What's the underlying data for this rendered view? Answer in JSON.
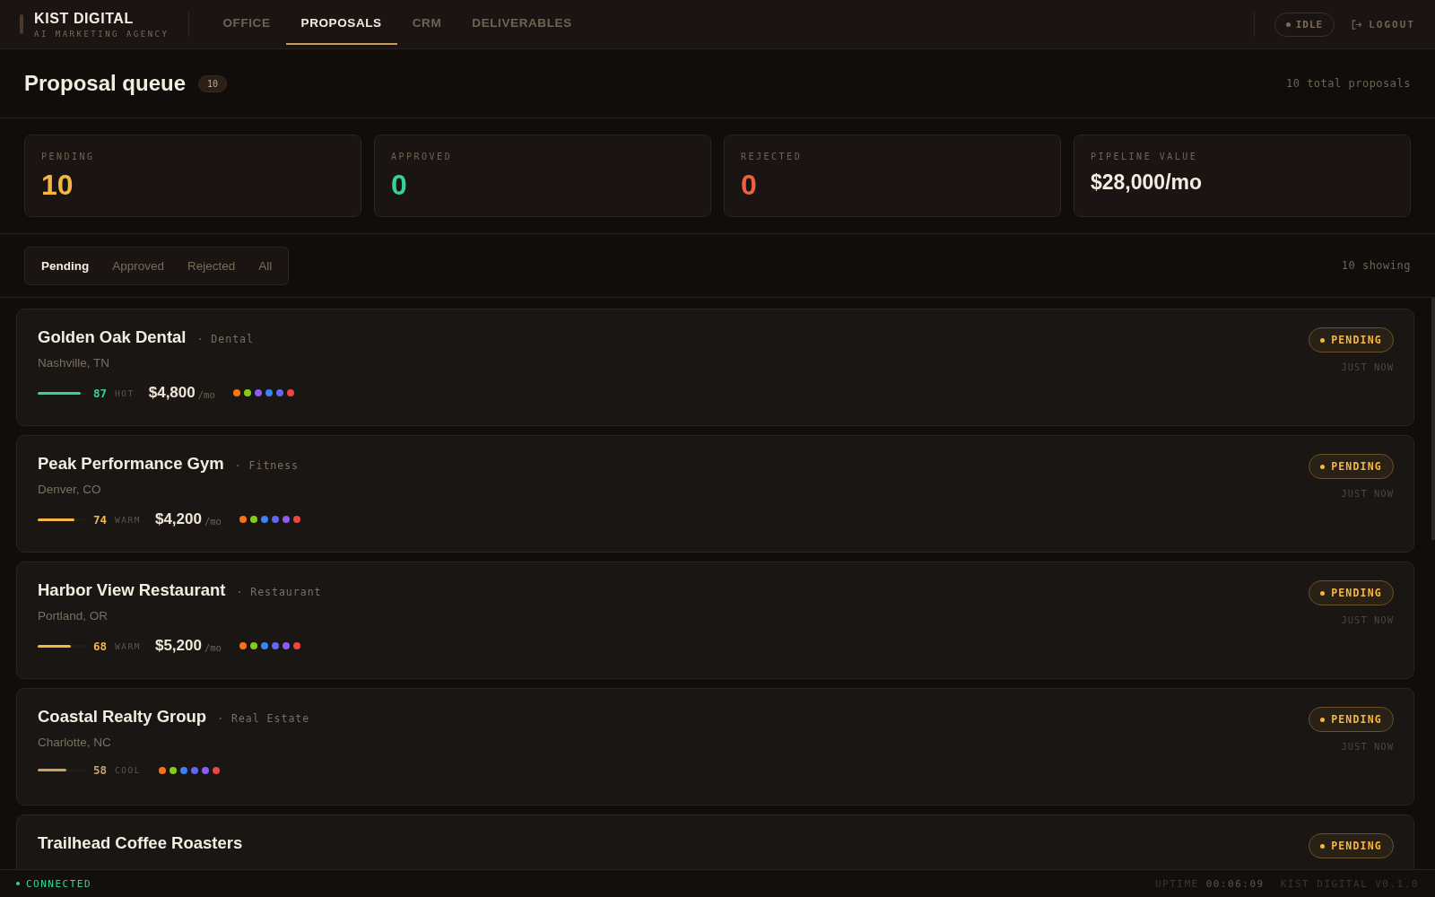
{
  "brand": {
    "name": "KIST DIGITAL",
    "tagline": "AI MARKETING AGENCY"
  },
  "nav": [
    {
      "label": "OFFICE",
      "selected": false
    },
    {
      "label": "PROPOSALS",
      "selected": true
    },
    {
      "label": "CRM",
      "selected": false
    },
    {
      "label": "DELIVERABLES",
      "selected": false
    }
  ],
  "status_pill": {
    "label": "IDLE"
  },
  "logout": {
    "label": "LOGOUT"
  },
  "page": {
    "title": "Proposal queue",
    "count": "10",
    "total": "10 total proposals"
  },
  "stats": [
    {
      "label": "PENDING",
      "value": "10",
      "color": "#f5b642"
    },
    {
      "label": "APPROVED",
      "value": "0",
      "color": "#34d399"
    },
    {
      "label": "REJECTED",
      "value": "0",
      "color": "#f0603f"
    },
    {
      "label": "PIPELINE VALUE",
      "value": "$28,000/mo",
      "color": "#f3ece0"
    }
  ],
  "filters": [
    {
      "label": "Pending",
      "selected": true
    },
    {
      "label": "Approved",
      "selected": false
    },
    {
      "label": "Rejected",
      "selected": false
    },
    {
      "label": "All",
      "selected": false
    }
  ],
  "showing": "10 showing",
  "proposals": [
    {
      "name": "Golden Oak Dental",
      "category": "· Dental",
      "location": "Nashville, TN",
      "score": "87",
      "color": "#34d399",
      "heat_label": "HOT",
      "level": 0.87,
      "price": "$4,800",
      "per": "/mo",
      "status": "PENDING",
      "time": "JUST NOW",
      "agents": [
        {
          "color": "#f97316"
        },
        {
          "color": "#84cc16"
        },
        {
          "color": "#8b5cf6"
        },
        {
          "color": "#3b82f6"
        },
        {
          "color": "#6366f1"
        },
        {
          "color": "#ef4444"
        }
      ]
    },
    {
      "name": "Peak Performance Gym",
      "category": "· Fitness",
      "location": "Denver, CO",
      "score": "74",
      "color": "#f5b642",
      "heat_label": "WARM",
      "level": 0.74,
      "price": "$4,200",
      "per": "/mo",
      "status": "PENDING",
      "time": "JUST NOW",
      "agents": [
        {
          "color": "#f97316"
        },
        {
          "color": "#84cc16"
        },
        {
          "color": "#3b82f6"
        },
        {
          "color": "#6366f1"
        },
        {
          "color": "#8b5cf6"
        },
        {
          "color": "#ef4444"
        }
      ]
    },
    {
      "name": "Harbor View Restaurant",
      "category": "· Restaurant",
      "location": "Portland, OR",
      "score": "68",
      "color": "#f5b642",
      "heat_label": "WARM",
      "level": 0.68,
      "price": "$5,200",
      "per": "/mo",
      "status": "PENDING",
      "time": "JUST NOW",
      "agents": [
        {
          "color": "#f97316"
        },
        {
          "color": "#84cc16"
        },
        {
          "color": "#3b82f6"
        },
        {
          "color": "#6366f1"
        },
        {
          "color": "#8b5cf6"
        },
        {
          "color": "#ef4444"
        }
      ]
    },
    {
      "name": "Coastal Realty Group",
      "category": "· Real Estate",
      "location": "Charlotte, NC",
      "score": "58",
      "color": "#c9a35f",
      "heat_label": "COOL",
      "level": 0.58,
      "status": "PENDING",
      "time": "JUST NOW",
      "agents": [
        {
          "color": "#f97316"
        },
        {
          "color": "#84cc16"
        },
        {
          "color": "#3b82f6"
        },
        {
          "color": "#6366f1"
        },
        {
          "color": "#8b5cf6"
        },
        {
          "color": "#ef4444"
        }
      ]
    },
    {
      "name": "Trailhead Coffee Roasters",
      "status": "PENDING"
    }
  ],
  "footer": {
    "connection": "CONNECTED",
    "uptime_label": "UPTIME",
    "uptime": "00:06:09",
    "version": "KIST DIGITAL V0.1.0"
  }
}
